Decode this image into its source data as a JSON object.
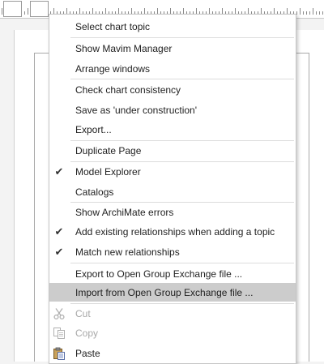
{
  "ruler": {
    "origin_label": "0"
  },
  "menu": {
    "highlight": "#cccccc",
    "groups": [
      [
        "Select chart topic"
      ],
      [
        "Show Mavim Manager",
        "Arrange windows"
      ],
      [
        "Check chart consistency",
        "Save as 'under construction'",
        "Export..."
      ],
      [
        "Duplicate Page"
      ],
      [
        "Model Explorer",
        "Catalogs"
      ],
      [
        "Show ArchiMate errors",
        "Add existing relationships when adding a topic",
        "Match new relationships"
      ],
      [
        "Export to Open Group Exchange file ...",
        "Import from Open Group Exchange file ..."
      ]
    ],
    "checked_items": [
      "Model Explorer",
      "Add existing relationships when adding a topic",
      "Match new relationships"
    ],
    "highlighted_item": "Import from Open Group Exchange file ...",
    "clipboard": {
      "cut": {
        "label": "Cut",
        "icon": "scissors-icon",
        "enabled": false
      },
      "copy": {
        "label": "Copy",
        "icon": "copy-icon",
        "enabled": false
      },
      "paste": {
        "label": "Paste",
        "icon": "clipboard-paste-icon",
        "enabled": true
      }
    }
  }
}
